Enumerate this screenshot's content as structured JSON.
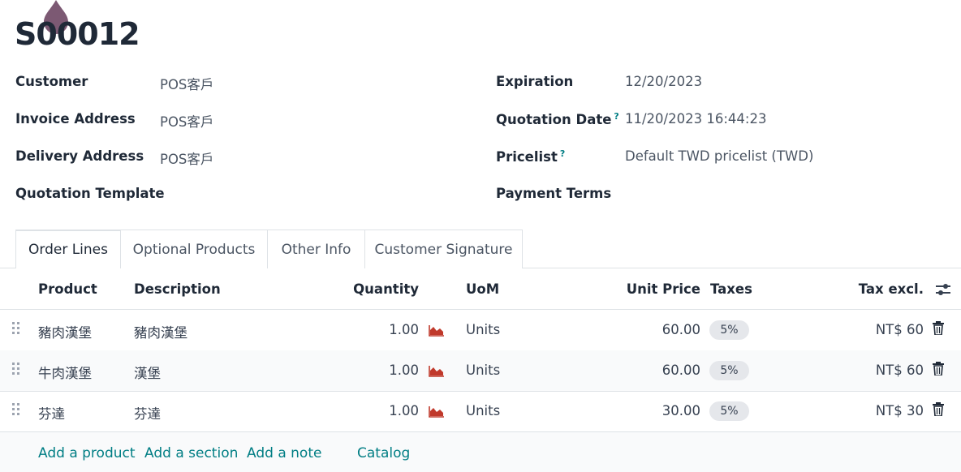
{
  "record": {
    "title": "S00012"
  },
  "fields_left": [
    {
      "label": "Customer",
      "value": "POS客戶"
    },
    {
      "label": "Invoice Address",
      "value": "POS客戶"
    },
    {
      "label": "Delivery Address",
      "value": "POS客戶"
    },
    {
      "label": "Quotation Template",
      "value": ""
    }
  ],
  "fields_right": [
    {
      "label": "Expiration",
      "help": "",
      "value": "12/20/2023"
    },
    {
      "label": "Quotation Date",
      "help": "?",
      "value": "11/20/2023 16:44:23"
    },
    {
      "label": "Pricelist",
      "help": "?",
      "value": "Default TWD pricelist (TWD)"
    },
    {
      "label": "Payment Terms",
      "help": "",
      "value": ""
    }
  ],
  "tabs": [
    {
      "label": "Order Lines",
      "active": true
    },
    {
      "label": "Optional Products",
      "active": false
    },
    {
      "label": "Other Info",
      "active": false
    },
    {
      "label": "Customer Signature",
      "active": false
    }
  ],
  "columns": {
    "product": "Product",
    "description": "Description",
    "quantity": "Quantity",
    "uom": "UoM",
    "unit_price": "Unit Price",
    "taxes": "Taxes",
    "subtotal": "Tax excl."
  },
  "rows": [
    {
      "product": "豬肉漢堡",
      "description": "豬肉漢堡",
      "quantity": "1.00",
      "uom": "Units",
      "unit_price": "60.00",
      "tax": "5%",
      "subtotal": "NT$ 60"
    },
    {
      "product": "牛肉漢堡",
      "description": "漢堡",
      "quantity": "1.00",
      "uom": "Units",
      "unit_price": "60.00",
      "tax": "5%",
      "subtotal": "NT$ 60"
    },
    {
      "product": "芬達",
      "description": "芬達",
      "quantity": "1.00",
      "uom": "Units",
      "unit_price": "30.00",
      "tax": "5%",
      "subtotal": "NT$ 30"
    }
  ],
  "actions": {
    "add_product": "Add a product",
    "add_section": "Add a section",
    "add_note": "Add a note",
    "catalog": "Catalog"
  },
  "colors": {
    "link": "#017e84",
    "forecast_icon": "#c0392b",
    "brand_drop": "#714b67"
  },
  "icons": [
    "drag-handle-icon",
    "forecast-chart-icon",
    "trash-icon",
    "column-settings-icon"
  ]
}
